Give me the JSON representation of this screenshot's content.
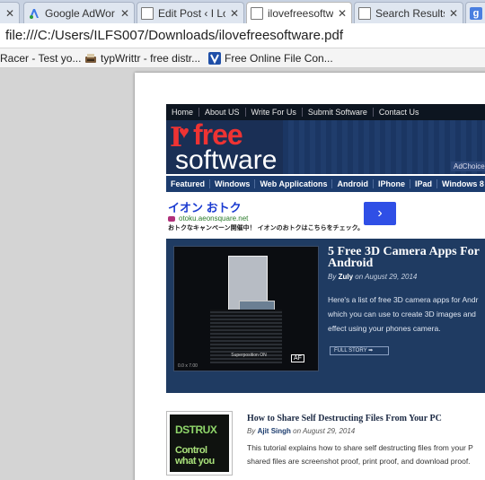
{
  "browser": {
    "tabs": [
      {
        "title": "Google AdWor",
        "icon": "adwords-icon"
      },
      {
        "title": "Edit Post ‹ I Lov",
        "icon": "page-icon"
      },
      {
        "title": "ilovefreesoftwa",
        "icon": "page-icon",
        "active": true
      },
      {
        "title": "Search Results",
        "icon": "page-icon"
      },
      {
        "title": "g",
        "icon": "google-icon"
      }
    ],
    "address": "file:///C:/Users/ILFS007/Downloads/ilovefreesoftware.pdf",
    "bookmarks": [
      {
        "label": "Racer - Test yo..."
      },
      {
        "label": "typWrittr - free distr..."
      },
      {
        "label": "Free Online File Con..."
      }
    ]
  },
  "site": {
    "top_nav": [
      "Home",
      "About US",
      "Write For Us",
      "Submit Software",
      "Contact Us"
    ],
    "logo": {
      "i": "I",
      "free": "free",
      "software": "software"
    },
    "adchoices": "AdChoices",
    "main_nav": [
      "Featured",
      "Windows",
      "Web Applications",
      "Android",
      "IPhone",
      "IPad",
      "Windows 8",
      "So"
    ],
    "ad": {
      "title": "イオン おトク",
      "url": "otoku.aeonsquare.net",
      "desc": "おトクなキャンペーン開催中！ イオンのおトクはこちらをチェック。",
      "button": "›"
    },
    "featured": {
      "title": "5 Free 3D Camera Apps For Android",
      "by": "By",
      "author": "Zuly",
      "date": "on August 29, 2014",
      "desc": "Here's a list of free 3D camera apps for Andr which you can use to create 3D images and effect using your phones camera.",
      "full_story": "FULL STORY ➡",
      "img_caption": "Superposition ON",
      "img_af": "AF",
      "img_scale": "0.0 x 7.00"
    },
    "post": {
      "title": "How to Share Self Destructing Files From Your PC",
      "by": "By",
      "author": "Ajit Singh",
      "date": "on August 29, 2014",
      "desc": "This tutorial explains how to share self destructing files from your P shared files are screenshot proof, print proof, and download proof.",
      "thumb_line1": "DSTRUX",
      "thumb_line2": "Control what you"
    }
  }
}
